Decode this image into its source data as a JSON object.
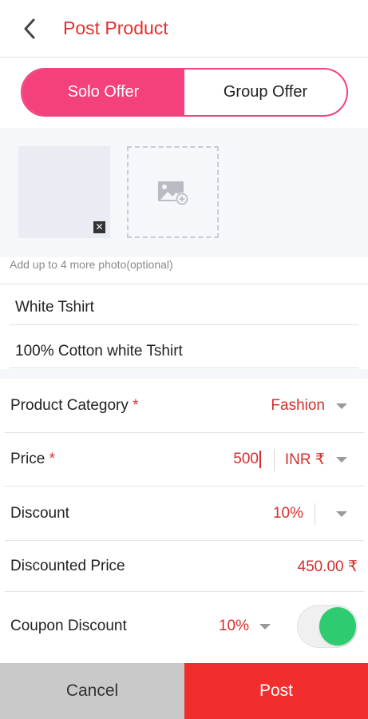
{
  "header": {
    "title": "Post Product",
    "back_icon": "chevron-left-icon"
  },
  "offer_tabs": [
    {
      "label": "Solo Offer",
      "active": true
    },
    {
      "label": "Group Offer",
      "active": false
    }
  ],
  "photos": {
    "hint": "Add up to 4 more photo(optional)",
    "remove_glyph": "✕",
    "add_icon": "image-add-icon"
  },
  "fields": {
    "product_name": "White Tshirt",
    "description": "100% Cotton white Tshirt"
  },
  "rows": {
    "category": {
      "label": "Product Category",
      "required_mark": "*",
      "value": "Fashion"
    },
    "price": {
      "label": "Price",
      "required_mark": "*",
      "value": "500",
      "currency": "INR ₹"
    },
    "discount": {
      "label": "Discount",
      "value": "10%"
    },
    "discounted_price": {
      "label": "Discounted Price",
      "value": "450.00 ₹"
    },
    "coupon_discount": {
      "label": "Coupon Discount",
      "value": "10%",
      "enabled": true
    }
  },
  "actions": {
    "cancel": "Cancel",
    "post": "Post"
  },
  "colors": {
    "accent_red": "#e62e2e",
    "toggle_pink": "#f4417c",
    "switch_green": "#2ecc71",
    "post_red": "#f22d2d",
    "cancel_gray": "#c9c9c9"
  }
}
